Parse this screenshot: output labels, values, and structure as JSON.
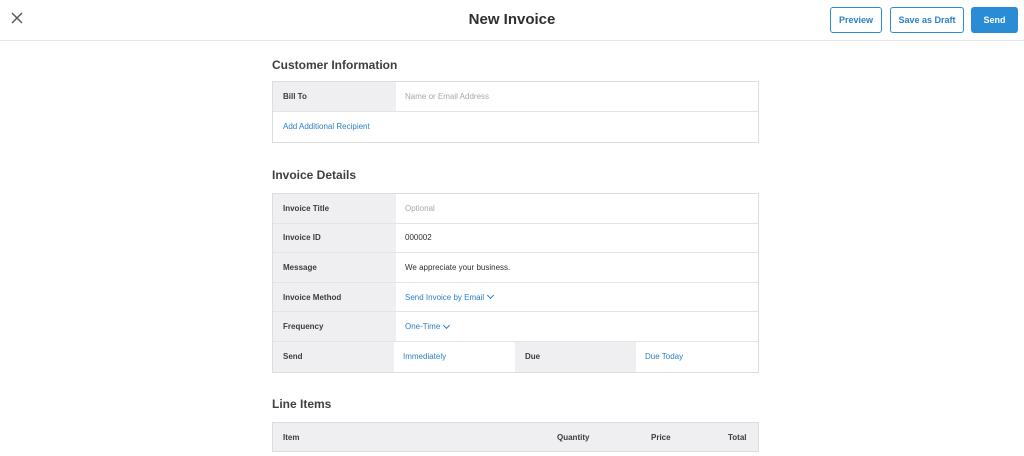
{
  "header": {
    "title": "New Invoice",
    "preview_label": "Preview",
    "draft_label": "Save as Draft",
    "send_label": "Send"
  },
  "customer": {
    "heading": "Customer Information",
    "bill_to_label": "Bill To",
    "bill_to_placeholder": "Name or Email Address",
    "add_recipient": "Add Additional Recipient"
  },
  "details": {
    "heading": "Invoice Details",
    "title_label": "Invoice Title",
    "title_placeholder": "Optional",
    "id_label": "Invoice ID",
    "id_value": "000002",
    "message_label": "Message",
    "message_value": "We appreciate your business.",
    "method_label": "Invoice Method",
    "method_value": "Send Invoice by Email",
    "frequency_label": "Frequency",
    "frequency_value": "One-Time",
    "send_label": "Send",
    "send_value": "Immediately",
    "due_label": "Due",
    "due_value": "Due Today"
  },
  "line_items": {
    "heading": "Line Items",
    "columns": [
      "Item",
      "Quantity",
      "Price",
      "Total"
    ]
  },
  "colors": {
    "accent": "#2b8cd6",
    "link": "#2b7fc4",
    "label_bg": "#efeff1"
  },
  "icons": {
    "close": "close-icon",
    "dropdown": "chevron-down-icon"
  }
}
